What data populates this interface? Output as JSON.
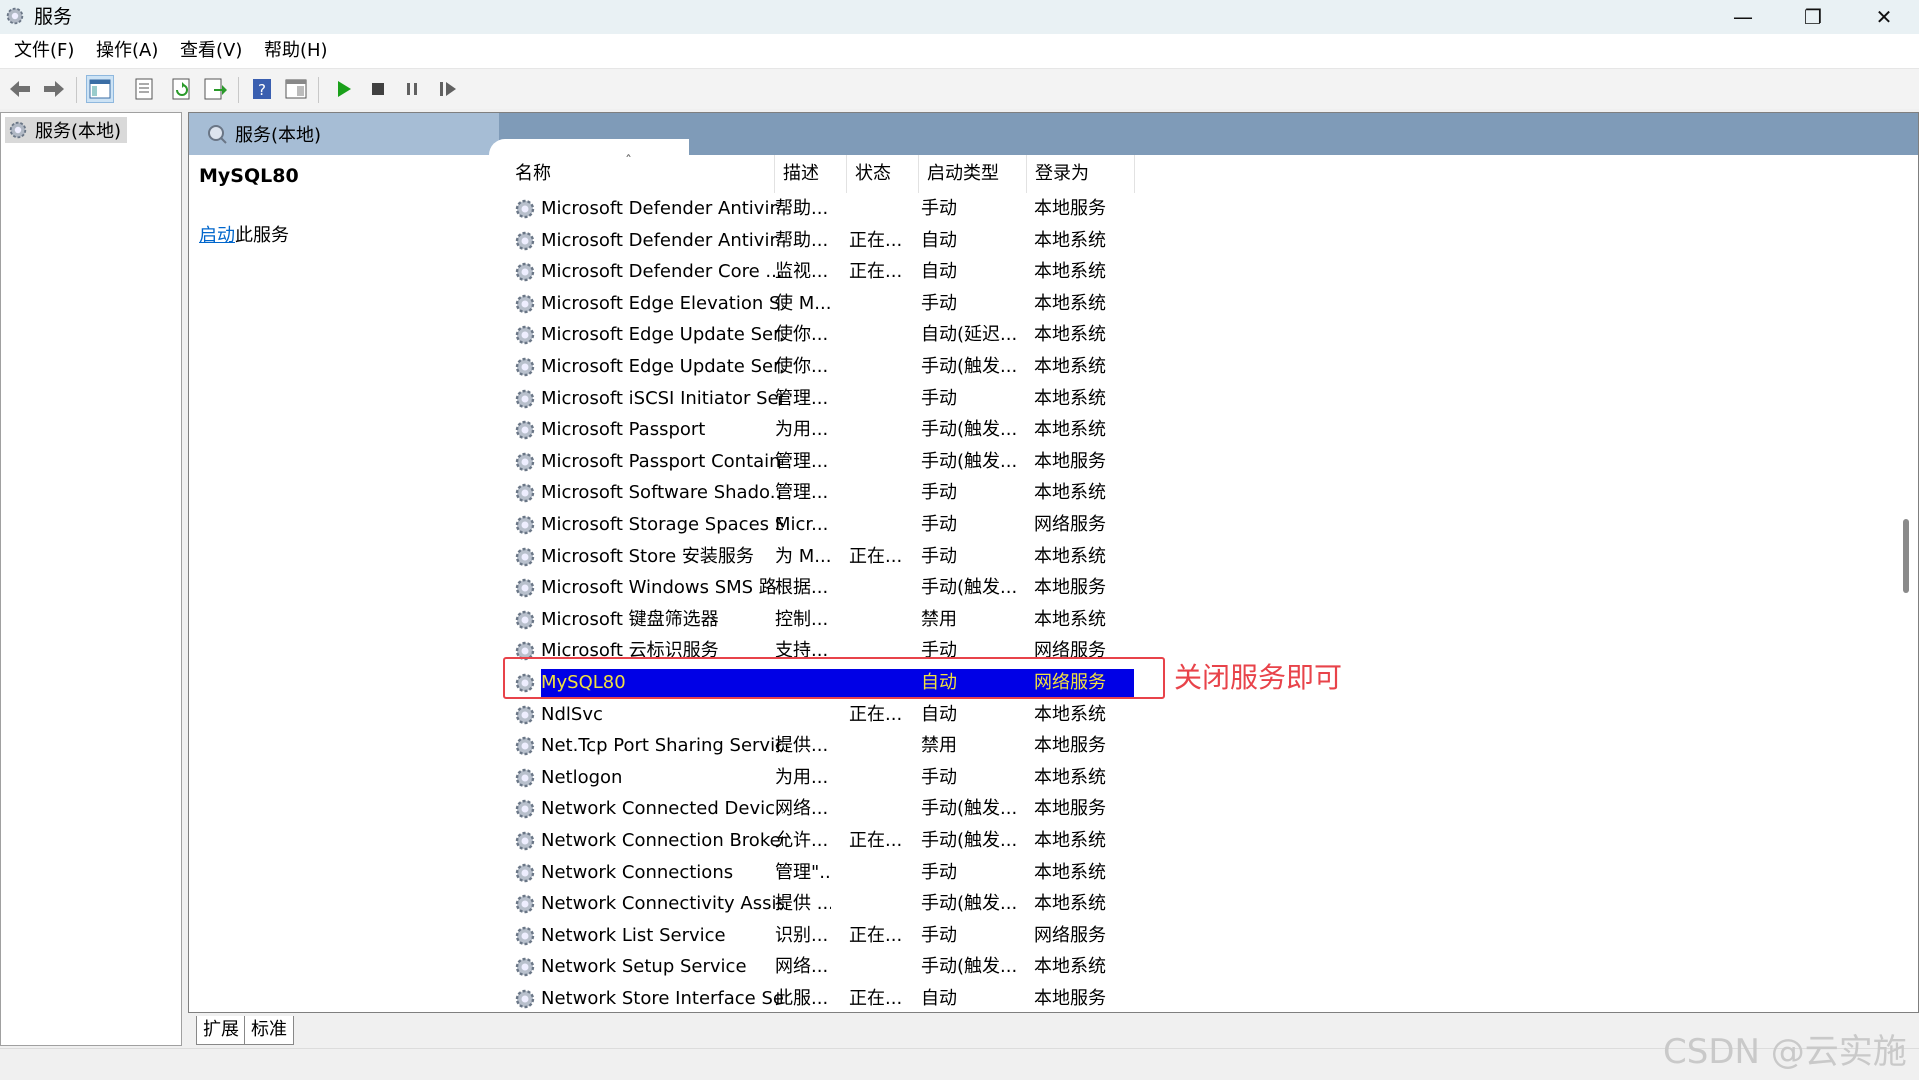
{
  "window": {
    "title": "服务"
  },
  "menu": [
    "文件(F)",
    "操作(A)",
    "查看(V)",
    "帮助(H)"
  ],
  "tree": {
    "root_label": "服务(本地)"
  },
  "panel": {
    "header_label": "服务(本地)",
    "selected_service": "MySQL80",
    "action_link": "启动",
    "action_suffix": "此服务"
  },
  "table": {
    "columns": [
      "名称",
      "描述",
      "状态",
      "启动类型",
      "登录为"
    ],
    "rows": [
      {
        "name": "Microsoft Defender Antivir...",
        "desc": "帮助...",
        "status": "",
        "startup": "手动",
        "logon": "本地服务"
      },
      {
        "name": "Microsoft Defender Antivir...",
        "desc": "帮助...",
        "status": "正在...",
        "startup": "自动",
        "logon": "本地系统"
      },
      {
        "name": "Microsoft Defender Core ...",
        "desc": "监视...",
        "status": "正在...",
        "startup": "自动",
        "logon": "本地系统"
      },
      {
        "name": "Microsoft Edge Elevation S...",
        "desc": "使 M...",
        "status": "",
        "startup": "手动",
        "logon": "本地系统"
      },
      {
        "name": "Microsoft Edge Update Ser...",
        "desc": "使你...",
        "status": "",
        "startup": "自动(延迟...",
        "logon": "本地系统"
      },
      {
        "name": "Microsoft Edge Update Ser...",
        "desc": "使你...",
        "status": "",
        "startup": "手动(触发...",
        "logon": "本地系统"
      },
      {
        "name": "Microsoft iSCSI Initiator Ser...",
        "desc": "管理...",
        "status": "",
        "startup": "手动",
        "logon": "本地系统"
      },
      {
        "name": "Microsoft Passport",
        "desc": "为用...",
        "status": "",
        "startup": "手动(触发...",
        "logon": "本地系统"
      },
      {
        "name": "Microsoft Passport Container",
        "desc": "管理...",
        "status": "",
        "startup": "手动(触发...",
        "logon": "本地服务"
      },
      {
        "name": "Microsoft Software Shado...",
        "desc": "管理...",
        "status": "",
        "startup": "手动",
        "logon": "本地系统"
      },
      {
        "name": "Microsoft Storage Spaces S...",
        "desc": "Micr...",
        "status": "",
        "startup": "手动",
        "logon": "网络服务"
      },
      {
        "name": "Microsoft Store 安装服务",
        "desc": "为 M...",
        "status": "正在...",
        "startup": "手动",
        "logon": "本地系统"
      },
      {
        "name": "Microsoft Windows SMS 路...",
        "desc": "根据...",
        "status": "",
        "startup": "手动(触发...",
        "logon": "本地服务"
      },
      {
        "name": "Microsoft 键盘筛选器",
        "desc": "控制...",
        "status": "",
        "startup": "禁用",
        "logon": "本地系统"
      },
      {
        "name": "Microsoft 云标识服务",
        "desc": "支持...",
        "status": "",
        "startup": "手动",
        "logon": "网络服务"
      },
      {
        "name": "MySQL80",
        "desc": "",
        "status": "",
        "startup": "自动",
        "logon": "网络服务"
      },
      {
        "name": "NdlSvc",
        "desc": "",
        "status": "正在...",
        "startup": "自动",
        "logon": "本地系统"
      },
      {
        "name": "Net.Tcp Port Sharing Service",
        "desc": "提供...",
        "status": "",
        "startup": "禁用",
        "logon": "本地服务"
      },
      {
        "name": "Netlogon",
        "desc": "为用...",
        "status": "",
        "startup": "手动",
        "logon": "本地系统"
      },
      {
        "name": "Network Connected Devic...",
        "desc": "网络...",
        "status": "",
        "startup": "手动(触发...",
        "logon": "本地服务"
      },
      {
        "name": "Network Connection Broker",
        "desc": "允许...",
        "status": "正在...",
        "startup": "手动(触发...",
        "logon": "本地系统"
      },
      {
        "name": "Network Connections",
        "desc": "管理\"...",
        "status": "",
        "startup": "手动",
        "logon": "本地系统"
      },
      {
        "name": "Network Connectivity Assis...",
        "desc": "提供 ...",
        "status": "",
        "startup": "手动(触发...",
        "logon": "本地系统"
      },
      {
        "name": "Network List Service",
        "desc": "识别...",
        "status": "正在...",
        "startup": "手动",
        "logon": "网络服务"
      },
      {
        "name": "Network Setup Service",
        "desc": "网络...",
        "status": "",
        "startup": "手动(触发...",
        "logon": "本地系统"
      },
      {
        "name": "Network Store Interface Se...",
        "desc": "此服...",
        "status": "正在...",
        "startup": "自动",
        "logon": "本地服务"
      }
    ],
    "selected_index": 15
  },
  "tabs": [
    "扩展",
    "标准"
  ],
  "annotation": {
    "text": "关闭服务即可",
    "color": "#e8434a"
  },
  "watermark": "CSDN @云实施",
  "colors": {
    "selection_bg": "#0000e6",
    "selection_text": "#f0e040",
    "header_bg": "#7f9bb8",
    "link": "#0066cc"
  }
}
